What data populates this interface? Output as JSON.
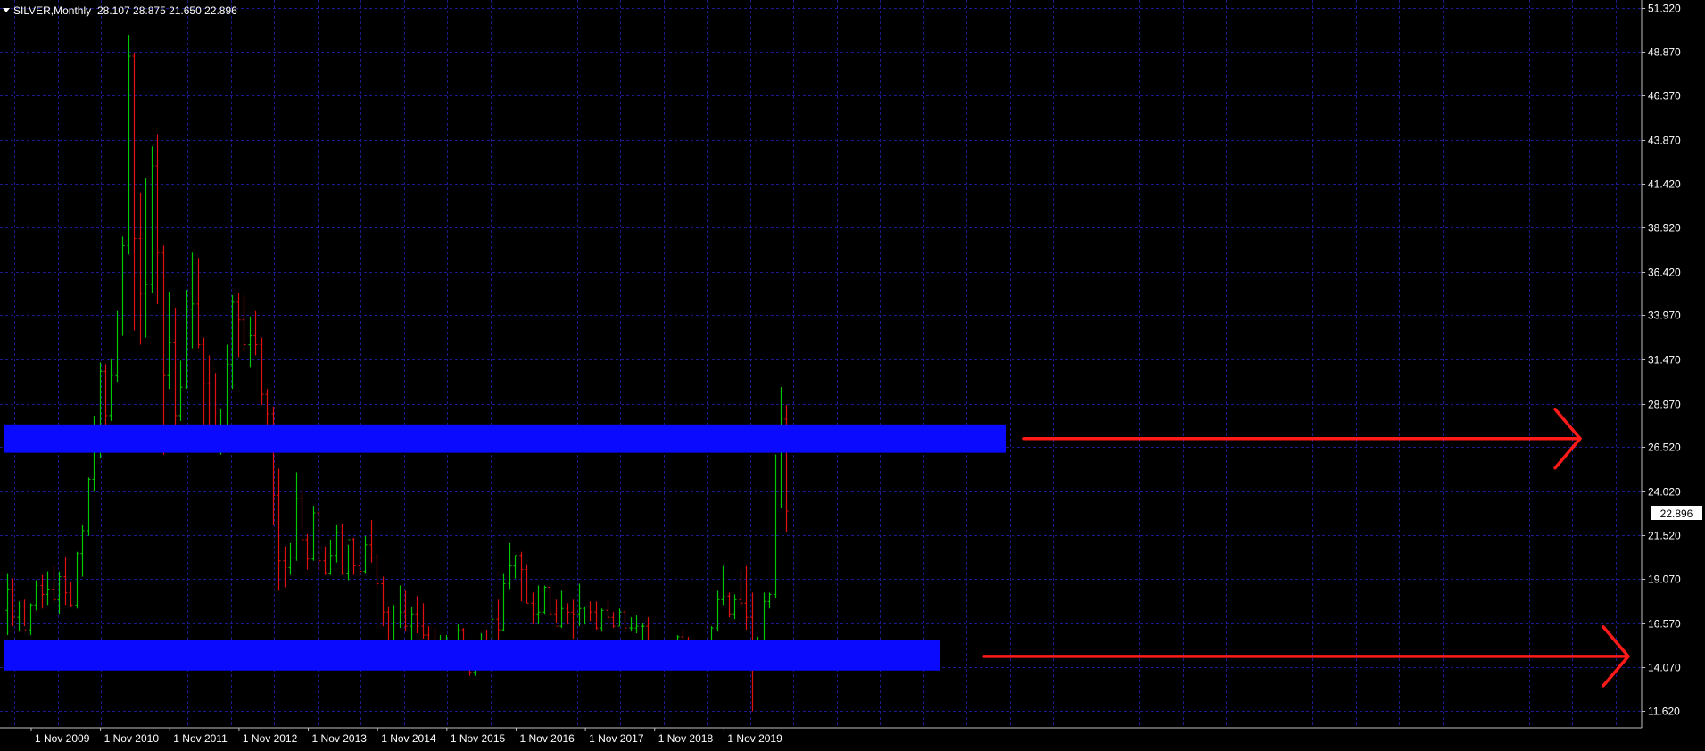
{
  "header": {
    "symbol_label": "SILVER,Monthly",
    "ohlc_label": "28.107 28.875 21.650 22.896",
    "menu_icon": "triangle-down-icon"
  },
  "current_price_label": "22.896",
  "colors": {
    "background": "#000000",
    "grid": "#1b1b8f",
    "axis": "#c0c0c0",
    "bull": "#00c800",
    "bear": "#e01010",
    "zone": "#0a0aff",
    "arrow": "#ff1a1a",
    "text": "#ffffff"
  },
  "chart_data": {
    "type": "ohlc",
    "title": "",
    "ylim": [
      11.0,
      52.0
    ],
    "y_ticks": [
      11.62,
      14.07,
      16.57,
      19.07,
      21.52,
      24.02,
      26.52,
      28.97,
      31.47,
      33.97,
      36.42,
      38.92,
      41.42,
      43.87,
      46.37,
      48.87,
      51.32
    ],
    "y_tick_labels": [
      "11.620",
      "14.070",
      "16.570",
      "19.070",
      "21.520",
      "24.020",
      "26.520",
      "28.970",
      "31.470",
      "33.970",
      "36.420",
      "38.920",
      "41.420",
      "43.870",
      "46.370",
      "48.870",
      "51.320"
    ],
    "x_tick_labels": [
      "1 Nov 2009",
      "1 Nov 2010",
      "1 Nov 2011",
      "1 Nov 2012",
      "1 Nov 2013",
      "1 Nov 2014",
      "1 Nov 2015",
      "1 Nov 2016",
      "1 Nov 2017",
      "1 Nov 2018",
      "1 Nov 2019"
    ],
    "current_price": 22.896,
    "bars": [
      [
        17.3,
        19.4,
        15.9,
        18.5
      ],
      [
        18.5,
        19.1,
        16.4,
        16.9
      ],
      [
        16.9,
        17.8,
        16.1,
        17.5
      ],
      [
        17.5,
        17.9,
        16.4,
        16.2
      ],
      [
        16.2,
        17.7,
        15.9,
        17.6
      ],
      [
        17.6,
        19.0,
        17.3,
        18.7
      ],
      [
        18.7,
        19.3,
        17.4,
        18.2
      ],
      [
        18.2,
        19.5,
        17.6,
        18.5
      ],
      [
        18.5,
        19.8,
        17.7,
        17.9
      ],
      [
        17.9,
        19.5,
        17.1,
        19.2
      ],
      [
        19.2,
        20.3,
        17.6,
        18.3
      ],
      [
        18.3,
        18.9,
        17.5,
        17.6
      ],
      [
        17.6,
        20.6,
        17.4,
        20.5
      ],
      [
        20.5,
        22.1,
        19.2,
        21.8
      ],
      [
        21.8,
        24.8,
        21.5,
        24.7
      ],
      [
        24.7,
        28.3,
        24.0,
        26.9
      ],
      [
        26.9,
        31.3,
        25.9,
        30.8
      ],
      [
        30.8,
        31.2,
        26.4,
        28.3
      ],
      [
        28.3,
        31.5,
        28.0,
        30.6
      ],
      [
        30.6,
        34.2,
        30.2,
        33.8
      ],
      [
        33.8,
        38.4,
        32.8,
        37.9
      ],
      [
        37.9,
        49.8,
        37.4,
        48.6
      ],
      [
        48.6,
        48.8,
        33.1,
        38.3
      ],
      [
        38.3,
        40.9,
        32.3,
        35.2
      ],
      [
        35.2,
        41.7,
        32.7,
        35.7
      ],
      [
        35.7,
        43.5,
        35.2,
        42.4
      ],
      [
        42.4,
        44.2,
        34.6,
        37.5
      ],
      [
        37.5,
        37.9,
        26.1,
        30.6
      ],
      [
        30.6,
        35.3,
        29.8,
        32.4
      ],
      [
        32.4,
        34.4,
        26.9,
        28.3
      ],
      [
        28.3,
        31.4,
        28.0,
        29.9
      ],
      [
        29.9,
        35.4,
        29.8,
        34.3
      ],
      [
        34.3,
        37.5,
        32.1,
        34.6
      ],
      [
        34.6,
        37.2,
        32.1,
        32.3
      ],
      [
        32.3,
        32.7,
        27.5,
        30.1
      ],
      [
        30.1,
        31.7,
        26.2,
        27.6
      ],
      [
        27.6,
        30.7,
        27.3,
        26.8
      ],
      [
        26.8,
        28.7,
        26.1,
        27.6
      ],
      [
        27.6,
        32.3,
        26.9,
        31.2
      ],
      [
        31.2,
        35.1,
        29.8,
        34.7
      ],
      [
        34.7,
        35.2,
        31.6,
        33.7
      ],
      [
        33.7,
        35.1,
        31.9,
        32.3
      ],
      [
        32.3,
        33.9,
        31.0,
        32.8
      ],
      [
        32.8,
        34.2,
        31.7,
        32.3
      ],
      [
        32.3,
        32.7,
        28.9,
        29.5
      ],
      [
        29.5,
        29.8,
        26.7,
        28.4
      ],
      [
        28.4,
        28.8,
        22.1,
        23.8
      ],
      [
        23.8,
        25.3,
        18.4,
        20.1
      ],
      [
        20.1,
        20.9,
        18.6,
        19.7
      ],
      [
        19.7,
        21.1,
        19.3,
        20.3
      ],
      [
        20.3,
        25.1,
        20.1,
        23.6
      ],
      [
        23.6,
        24.0,
        21.9,
        21.3
      ],
      [
        21.3,
        21.6,
        19.6,
        20.2
      ],
      [
        20.2,
        23.2,
        20.1,
        22.8
      ],
      [
        22.8,
        22.9,
        19.5,
        20.1
      ],
      [
        20.1,
        20.9,
        19.3,
        19.4
      ],
      [
        19.4,
        21.3,
        19.3,
        20.4
      ],
      [
        20.4,
        22.1,
        20.0,
        21.7
      ],
      [
        21.7,
        22.2,
        19.3,
        19.4
      ],
      [
        19.4,
        21.0,
        19.0,
        21.3
      ],
      [
        21.3,
        21.4,
        19.3,
        19.8
      ],
      [
        19.8,
        20.9,
        19.2,
        19.5
      ],
      [
        19.5,
        21.5,
        19.4,
        21.0
      ],
      [
        21.0,
        22.4,
        20.0,
        20.3
      ],
      [
        20.3,
        20.5,
        18.6,
        18.8
      ],
      [
        18.8,
        19.2,
        16.4,
        17.2
      ],
      [
        17.2,
        17.5,
        14.5,
        15.6
      ],
      [
        15.6,
        17.6,
        15.1,
        16.6
      ],
      [
        16.6,
        18.7,
        16.3,
        17.2
      ],
      [
        17.2,
        18.4,
        16.1,
        16.4
      ],
      [
        16.4,
        17.5,
        15.6,
        17.1
      ],
      [
        17.1,
        18.1,
        16.0,
        16.4
      ],
      [
        16.4,
        17.7,
        15.7,
        15.9
      ],
      [
        15.9,
        16.4,
        15.2,
        15.6
      ],
      [
        15.6,
        16.3,
        14.6,
        14.6
      ],
      [
        14.6,
        15.9,
        14.4,
        14.8
      ],
      [
        14.8,
        15.9,
        14.4,
        15.5
      ],
      [
        15.5,
        15.6,
        14.1,
        14.4
      ],
      [
        14.4,
        16.5,
        14.3,
        16.2
      ],
      [
        16.2,
        16.3,
        14.5,
        14.6
      ],
      [
        14.6,
        15.0,
        13.6,
        13.8
      ],
      [
        13.8,
        14.5,
        13.6,
        14.2
      ],
      [
        14.2,
        16.0,
        14.0,
        15.4
      ],
      [
        15.4,
        16.2,
        14.5,
        14.9
      ],
      [
        14.9,
        17.8,
        14.7,
        16.8
      ],
      [
        16.8,
        17.9,
        15.5,
        16.2
      ],
      [
        16.2,
        19.4,
        16.1,
        18.8
      ],
      [
        18.8,
        21.1,
        18.5,
        19.8
      ],
      [
        19.8,
        20.4,
        19.1,
        20.4
      ],
      [
        20.4,
        20.6,
        17.8,
        19.6
      ],
      [
        19.6,
        19.9,
        17.7,
        17.7
      ],
      [
        17.7,
        18.3,
        16.5,
        17.1
      ],
      [
        17.1,
        18.7,
        16.5,
        17.2
      ],
      [
        17.2,
        18.7,
        17.1,
        18.6
      ],
      [
        18.6,
        18.7,
        17.1,
        17.1
      ],
      [
        17.1,
        17.9,
        16.6,
        16.4
      ],
      [
        16.4,
        18.4,
        16.3,
        17.4
      ],
      [
        17.4,
        17.7,
        16.5,
        17.2
      ],
      [
        17.2,
        17.9,
        15.7,
        17.1
      ],
      [
        17.1,
        18.8,
        16.4,
        17.4
      ],
      [
        17.4,
        17.5,
        16.5,
        17.5
      ],
      [
        17.5,
        17.8,
        16.7,
        17.2
      ],
      [
        17.2,
        17.8,
        16.2,
        16.3
      ],
      [
        16.3,
        17.4,
        16.1,
        17.3
      ],
      [
        17.3,
        17.9,
        16.8,
        16.9
      ],
      [
        16.9,
        17.2,
        16.3,
        16.4
      ],
      [
        16.4,
        17.4,
        16.4,
        17.2
      ],
      [
        17.2,
        17.3,
        16.5,
        16.3
      ],
      [
        16.3,
        16.9,
        16.1,
        16.3
      ],
      [
        16.3,
        17.0,
        16.0,
        16.4
      ],
      [
        16.4,
        16.6,
        15.6,
        16.4
      ],
      [
        16.4,
        16.9,
        15.4,
        15.5
      ],
      [
        15.5,
        15.6,
        14.3,
        14.6
      ],
      [
        14.6,
        14.9,
        14.0,
        14.1
      ],
      [
        14.1,
        14.8,
        13.9,
        14.2
      ],
      [
        14.2,
        15.3,
        13.9,
        15.4
      ],
      [
        15.4,
        15.9,
        15.1,
        15.8
      ],
      [
        15.8,
        16.2,
        15.2,
        15.5
      ],
      [
        15.5,
        15.8,
        14.7,
        15.1
      ],
      [
        15.1,
        15.4,
        14.6,
        14.9
      ],
      [
        14.9,
        15.2,
        14.2,
        14.4
      ],
      [
        14.4,
        15.3,
        14.3,
        14.9
      ],
      [
        14.9,
        16.4,
        14.7,
        16.3
      ],
      [
        16.3,
        18.4,
        16.1,
        17.9
      ],
      [
        17.9,
        19.8,
        17.6,
        18.1
      ],
      [
        18.1,
        18.3,
        16.9,
        17.1
      ],
      [
        17.1,
        18.2,
        16.8,
        17.9
      ],
      [
        17.9,
        19.6,
        17.5,
        17.7
      ],
      [
        17.7,
        19.8,
        16.2,
        16.9
      ],
      [
        16.9,
        18.3,
        11.6,
        14.6
      ],
      [
        14.6,
        15.8,
        13.9,
        15.3
      ],
      [
        15.3,
        18.3,
        15.2,
        17.8
      ],
      [
        17.8,
        18.3,
        17.4,
        18.2
      ],
      [
        18.2,
        26.1,
        18.0,
        26.5
      ],
      [
        26.5,
        29.9,
        23.1,
        28.1
      ],
      [
        28.1,
        28.9,
        21.7,
        22.9
      ]
    ]
  },
  "annotations": {
    "zones": [
      {
        "low": 26.2,
        "high": 27.8,
        "start_index": 0,
        "end_index": 152
      },
      {
        "low": 13.9,
        "high": 15.6,
        "start_index": 0,
        "end_index": 140
      }
    ],
    "arrows": [
      {
        "price": 27.0
      },
      {
        "price": 14.7
      }
    ]
  }
}
